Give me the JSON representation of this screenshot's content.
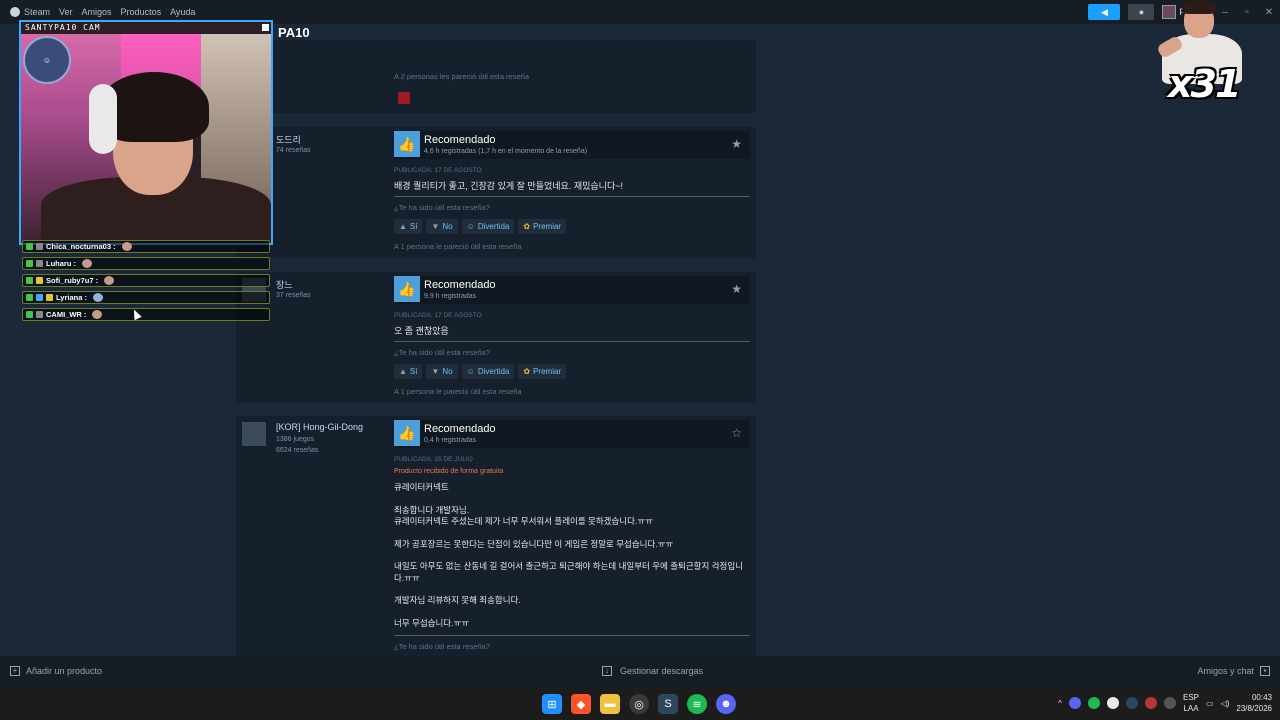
{
  "menubar": {
    "items": [
      "Steam",
      "Ver",
      "Amigos",
      "Productos",
      "Ayuda"
    ],
    "user_name": "Pa10",
    "caret": "⌄"
  },
  "page": {
    "title": "PA10"
  },
  "reviews": [
    {
      "helpful_count": "A 2 personas les pareció útil esta reseña"
    },
    {
      "author_name": "도드리",
      "author_reviews": "74 reseñas",
      "title": "Recomendado",
      "hours": "4,6 h registradas (1,7 h en el momento de la reseña)",
      "published": "PUBLICADA: 17 DE AGOSTO",
      "text": "배경 퀄리티가 좋고, 긴장감 있게 잘 만들었네요. 재밌습니다~!",
      "helpful_q": "¿Te ha sido útil esta reseña?",
      "vote_yes": "Sí",
      "vote_no": "No",
      "vote_funny": "Divertida",
      "vote_award": "Premiar",
      "helpful_count": "A 1 persona le pareció útil esta reseña"
    },
    {
      "author_name": "장느",
      "author_reviews": "37 reseñas",
      "title": "Recomendado",
      "hours": "9,9 h registradas",
      "published": "PUBLICADA: 17 DE AGOSTO",
      "text": "오 좀 괜찮았음",
      "helpful_q": "¿Te ha sido útil esta reseña?",
      "vote_yes": "Sí",
      "vote_no": "No",
      "vote_funny": "Divertida",
      "vote_award": "Premiar",
      "helpful_count": "A 1 persona le pareció útil esta reseña"
    },
    {
      "author_name": "[KOR] Hong-Gil-Dong",
      "author_games": "1386 juegos",
      "author_reviews": "6624 reseñas",
      "title": "Recomendado",
      "hours": "0,4 h registradas",
      "published": "PUBLICADA: 25 DE JULIO",
      "free_note": "Producto recibido de forma gratuita",
      "paragraphs": [
        "큐레이터커넥트",
        "죄송합니다 개발자님.\n큐레이터커넥트 주셨는데 제가 너무 무서워서 플레이를 못하겠습니다.ㅠㅠ",
        "제가 공포장르는 못한다는 단점이 있습니다만 이 게임은 정말로 무섭습니다.ㅠㅠ",
        "내일도 아무도 없는 산동네 길 걸어서 출근하고 퇴근해야 하는데 내일부터 우에 출퇴근할지 걱정입니다.ㅠㅠ",
        "개발자님 리뷰하지 못해 죄송합니다.",
        "너무 무섭습니다.ㅠㅠ"
      ],
      "helpful_q": "¿Te ha sido útil esta reseña?"
    }
  ],
  "bottom_bar": {
    "add_product": "Añadir un producto",
    "manage_downloads": "Gestionar descargas",
    "friends_chat": "Amigos y chat"
  },
  "taskbar": {
    "lang_top": "ESP",
    "lang_bottom": "LAA",
    "time": "00:43",
    "date": "23/8/2026"
  },
  "webcam": {
    "label": "SANTYPA10 CAM"
  },
  "chat": [
    {
      "user": "Chica_nocturna03 :"
    },
    {
      "user": "Luharu :"
    },
    {
      "user": "Sofi_ruby7u7 :"
    },
    {
      "user": "Lyriana :"
    },
    {
      "user": "CAMI_WR :"
    }
  ],
  "overlay": {
    "multiplier": "x31"
  },
  "colors": {
    "accent": "#1a9fff",
    "recommend_thumb": "#4c9fd8",
    "free_note": "#e57c4d",
    "chat_border": "#6b7a24"
  }
}
